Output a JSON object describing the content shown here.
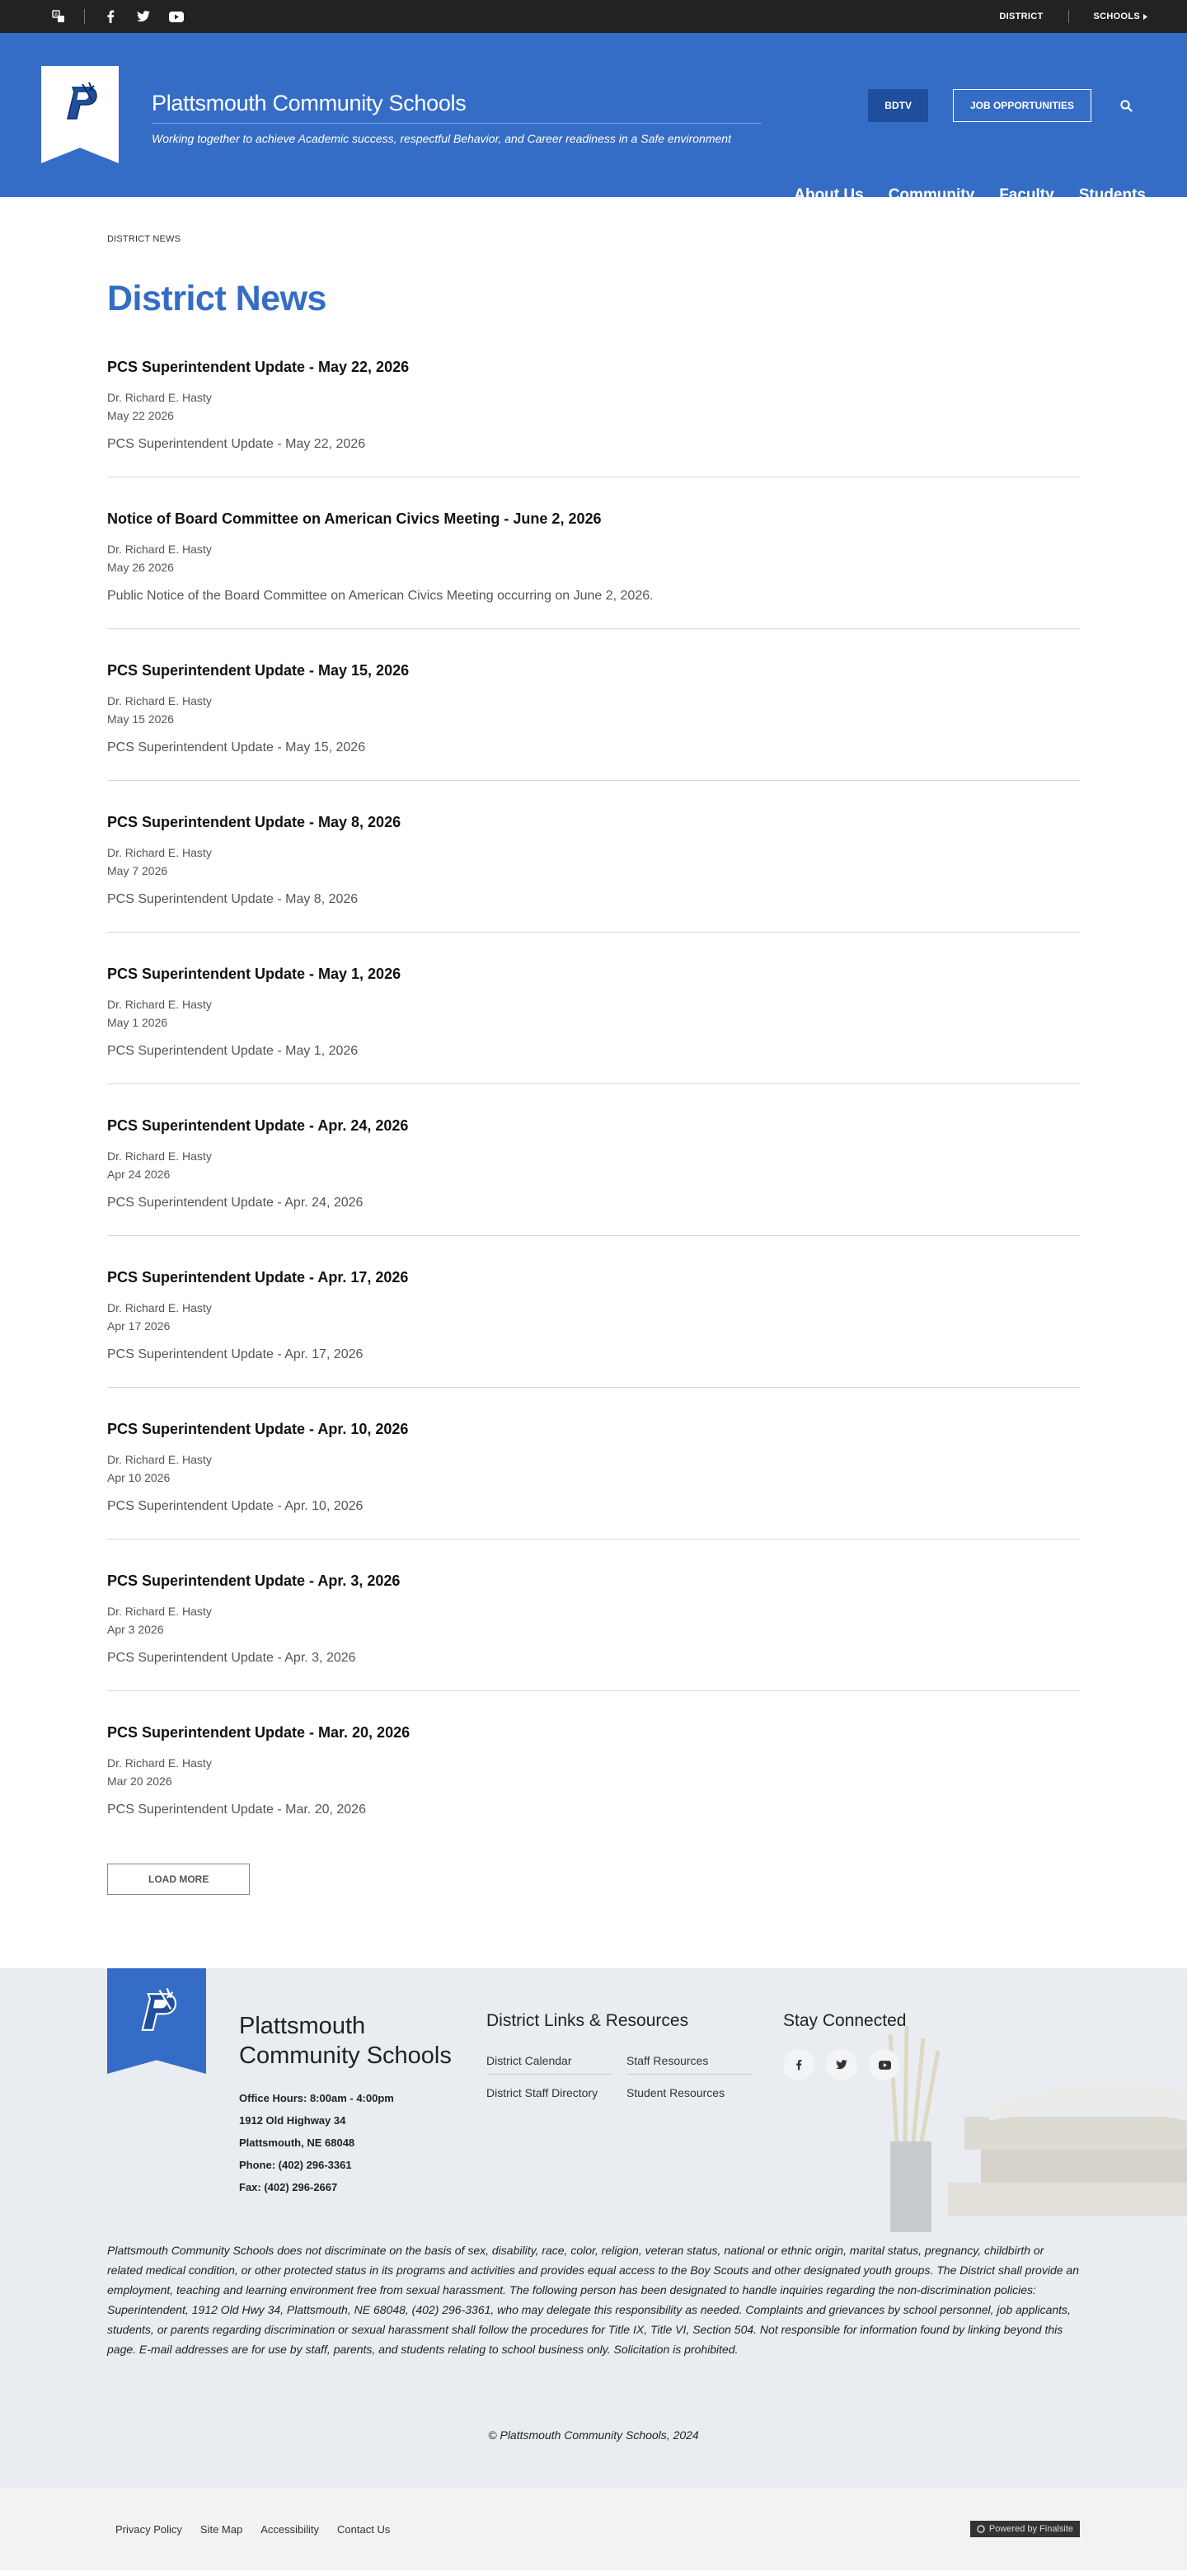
{
  "util_bar": {
    "district_label": "DISTRICT",
    "schools_label": "SCHOOLS",
    "icons": [
      "translate-icon",
      "facebook-icon",
      "twitter-icon",
      "youtube-icon"
    ]
  },
  "header": {
    "school_name": "Plattsmouth Community Schools",
    "tagline": "Working together to achieve Academic success, respectful Behavior, and Career readiness in a Safe environment",
    "bdtv_label": "BDTV",
    "jobs_label": "JOB OPPORTUNITIES",
    "nav": [
      "About Us",
      "Community",
      "Faculty",
      "Students"
    ],
    "brand_color": "#356dc6"
  },
  "main": {
    "breadcrumb": "DISTRICT NEWS",
    "title": "District News",
    "articles": [
      {
        "title": "PCS Superintendent Update - May 22, 2026",
        "author": "Dr. Richard E. Hasty",
        "date": "May 22 2026",
        "summary": "PCS Superintendent Update - May 22, 2026"
      },
      {
        "title": "Notice of Board Committee on American Civics Meeting - June 2, 2026",
        "author": "Dr. Richard E. Hasty",
        "date": "May 26 2026",
        "summary": "Public Notice of the Board Committee on American Civics Meeting occurring on June 2, 2026."
      },
      {
        "title": "PCS Superintendent Update - May 15, 2026",
        "author": "Dr. Richard E. Hasty",
        "date": "May 15 2026",
        "summary": "PCS Superintendent Update - May 15, 2026"
      },
      {
        "title": "PCS Superintendent Update - May 8, 2026",
        "author": "Dr. Richard E. Hasty",
        "date": "May 7 2026",
        "summary": "PCS Superintendent Update - May 8, 2026"
      },
      {
        "title": "PCS Superintendent Update - May 1, 2026",
        "author": "Dr. Richard E. Hasty",
        "date": "May 1 2026",
        "summary": "PCS Superintendent Update - May 1, 2026"
      },
      {
        "title": "PCS Superintendent Update - Apr. 24, 2026",
        "author": "Dr. Richard E. Hasty",
        "date": "Apr 24 2026",
        "summary": "PCS Superintendent Update - Apr. 24, 2026"
      },
      {
        "title": "PCS Superintendent Update - Apr. 17, 2026",
        "author": "Dr. Richard E. Hasty",
        "date": "Apr 17 2026",
        "summary": "PCS Superintendent Update - Apr. 17, 2026"
      },
      {
        "title": "PCS Superintendent Update - Apr. 10, 2026",
        "author": "Dr. Richard E. Hasty",
        "date": "Apr 10 2026",
        "summary": "PCS Superintendent Update - Apr. 10, 2026"
      },
      {
        "title": "PCS Superintendent Update - Apr. 3, 2026",
        "author": "Dr. Richard E. Hasty",
        "date": "Apr 3 2026",
        "summary": "PCS Superintendent Update - Apr. 3, 2026"
      },
      {
        "title": "PCS Superintendent Update - Mar. 20, 2026",
        "author": "Dr. Richard E. Hasty",
        "date": "Mar 20 2026",
        "summary": "PCS Superintendent Update - Mar. 20, 2026"
      }
    ],
    "load_more_label": "LOAD MORE"
  },
  "footer": {
    "school_name": "Plattsmouth Community Schools",
    "office_hours": "Office Hours: 8:00am - 4:00pm",
    "address1": "1912 Old Highway 34",
    "address2": "Plattsmouth, NE  68048",
    "phone": "Phone: (402) 296-3361",
    "fax": "Fax: (402) 296-2667",
    "links_heading": "District Links & Resources",
    "links": [
      "District Calendar",
      "Staff Resources",
      "District Staff Directory",
      "Student Resources"
    ],
    "stay_heading": "Stay Connected",
    "notice": "Plattsmouth Community Schools does not discriminate on the basis of sex, disability, race, color, religion, veteran status, national or ethnic origin, marital status, pregnancy, childbirth or related medical condition, or other protected status in its programs and activities and provides equal access to the Boy Scouts and other designated youth groups. The District shall provide an employment, teaching and learning environment free from sexual harassment. The following person has been designated to handle inquiries regarding the non-discrimination policies: Superintendent, 1912 Old Hwy 34, Plattsmouth, NE 68048, (402) 296-3361, who may delegate this responsibility as needed. Complaints and grievances by school personnel, job applicants, students, or parents regarding discrimination or sexual harassment shall follow the procedures for Title IX, Title VI, Section 504. Not responsible for information found by linking beyond this page. E-mail addresses are for use by staff, parents, and students relating to school business only. Solicitation is prohibited.",
    "copyright": "© Plattsmouth Community Schools, 2024"
  },
  "bottom_bar": {
    "links": [
      "Privacy Policy",
      "Site Map",
      "Accessibility",
      "Contact Us"
    ],
    "powered_by": "Powered by Finalsite"
  }
}
